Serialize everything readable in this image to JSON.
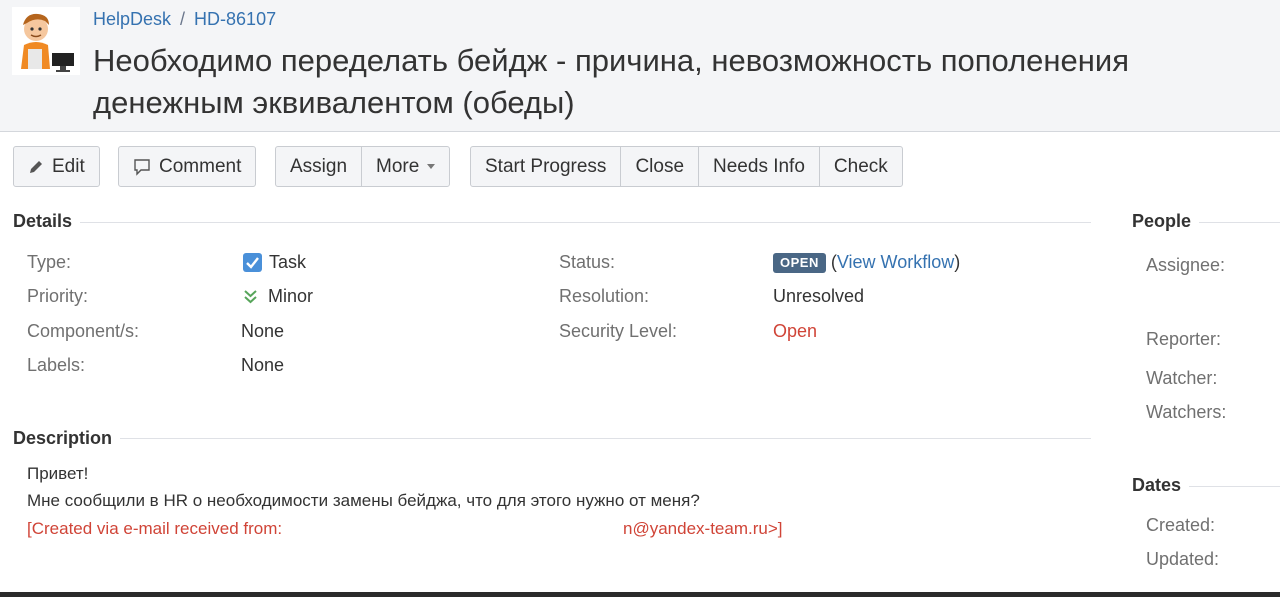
{
  "header": {
    "breadcrumb": {
      "project": "HelpDesk",
      "separator": "/",
      "issue_key": "HD-86107"
    },
    "title": "Необходимо переделать бейдж - причина, невозможность пополенения денежным эквивалентом (обеды)"
  },
  "toolbar": {
    "edit": "Edit",
    "comment": "Comment",
    "assign": "Assign",
    "more": "More",
    "start_progress": "Start Progress",
    "close": "Close",
    "needs_info": "Needs Info",
    "check": "Check"
  },
  "details": {
    "heading": "Details",
    "type_label": "Type:",
    "type_value": "Task",
    "priority_label": "Priority:",
    "priority_value": "Minor",
    "components_label": "Component/s:",
    "components_value": "None",
    "labels_label": "Labels:",
    "labels_value": "None",
    "status_label": "Status:",
    "status_value": "OPEN",
    "workflow_link": "View Workflow",
    "resolution_label": "Resolution:",
    "resolution_value": "Unresolved",
    "security_label": "Security Level:",
    "security_value": "Open"
  },
  "description": {
    "heading": "Description",
    "line1": "Привет!",
    "line2": "Мне сообщили в HR о необходимости замены бейджа, что для этого нужно от меня?",
    "line3_prefix": "[Created via e-mail received from:",
    "line3_suffix": "n@yandex-team.ru>]"
  },
  "people": {
    "heading": "People",
    "assignee_label": "Assignee:",
    "reporter_label": "Reporter:",
    "watcher_label": "Watcher:",
    "watchers_label": "Watchers:"
  },
  "dates": {
    "heading": "Dates",
    "created_label": "Created:",
    "updated_label": "Updated:"
  },
  "colors": {
    "link": "#3572b0",
    "status_lozenge": "#4a6785",
    "security_open": "#d04437",
    "task_icon": "#4a90d9",
    "priority_icon": "#57a55a"
  }
}
